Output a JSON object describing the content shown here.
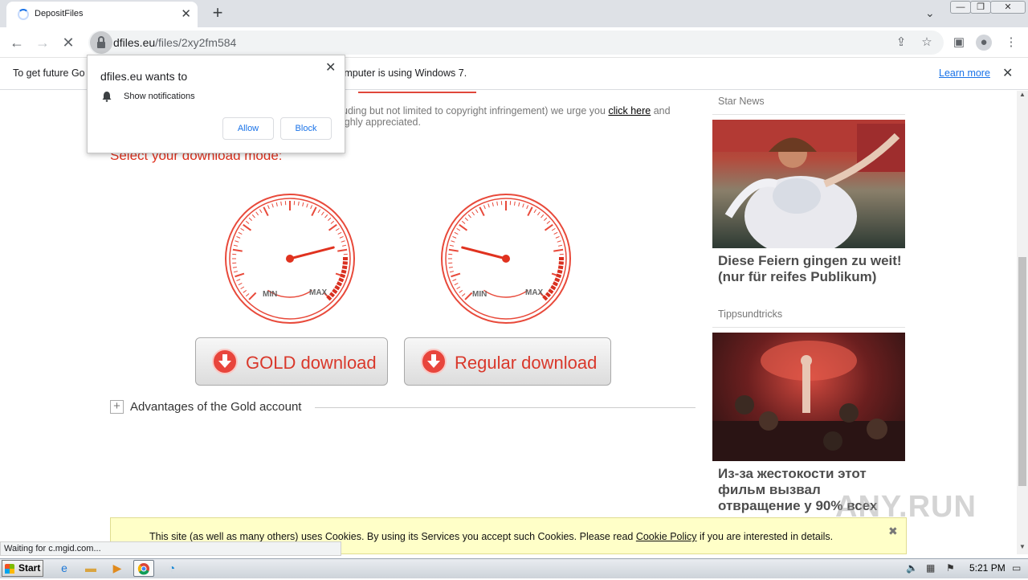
{
  "browser": {
    "tab_title": "DepositFiles",
    "url_domain": "dfiles.eu",
    "url_path": "/files/2xy2fm584"
  },
  "infobar": {
    "text_left": "To get future Go",
    "text_right": "is computer is using Windows 7.",
    "learn_more": "Learn more"
  },
  "permission": {
    "title": "dfiles.eu wants to",
    "item": "Show notifications",
    "allow": "Allow",
    "block": "Block"
  },
  "page": {
    "line1": "uding but not limited to copyright infringement) we urge you",
    "click_here": "click here",
    "line1_end": "and",
    "line2": "ighly appreciated.",
    "mode_title": "Select your download mode:",
    "gauge_min": "MIN",
    "gauge_max": "MAX",
    "gold_label": "GOLD download",
    "regular_label": "Regular download",
    "advantages": "Advantages of the Gold account"
  },
  "gauges": {
    "gold_level": 0.78,
    "regular_level": 0.22
  },
  "sidebar": {
    "star_news": "Star News",
    "ad1_title": "Diese Feiern gingen zu weit! (nur für reifes Publikum)",
    "ad1_source": "Tippsundtricks",
    "ad2_title": "Из-за жестокости этот фильм вызвал отвращение у 90% всех"
  },
  "cookie": {
    "text_before": "This site (as well as many others) uses Cookies. By using its Services you accept such Cookies. Please read",
    "link": "Cookie Policy",
    "text_after": "if you are interested in details."
  },
  "status": "Waiting for c.mgid.com...",
  "taskbar": {
    "start": "Start",
    "time": "5:21 PM"
  },
  "watermark": "ANY.RUN"
}
